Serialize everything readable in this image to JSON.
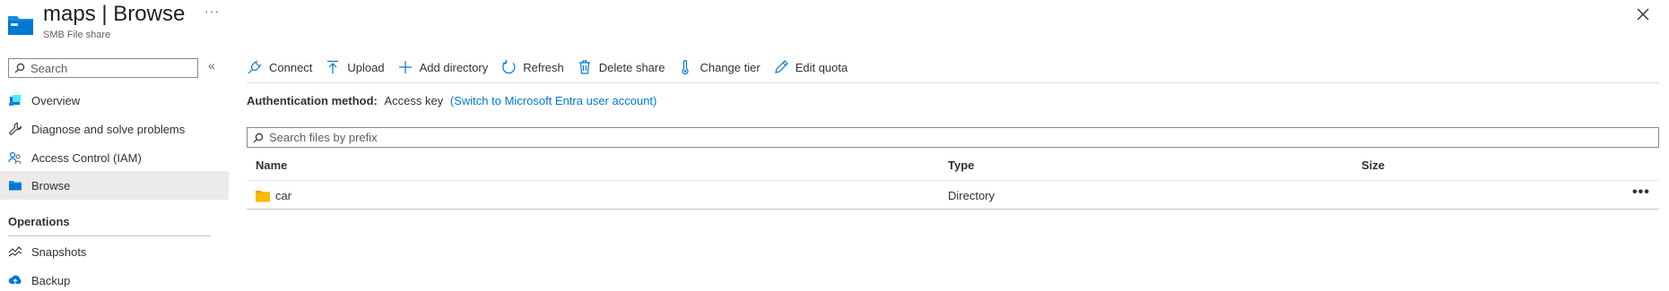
{
  "header": {
    "resource_name": "maps",
    "separator": "|",
    "page": "Browse",
    "subtitle": "SMB File share",
    "more": "···"
  },
  "sidebar": {
    "search_placeholder": "Search",
    "collapse_glyph": "«",
    "items": [
      {
        "label": "Overview",
        "icon": "overview-icon"
      },
      {
        "label": "Diagnose and solve problems",
        "icon": "wrench-icon"
      },
      {
        "label": "Access Control (IAM)",
        "icon": "people-icon"
      },
      {
        "label": "Browse",
        "icon": "folder-icon",
        "active": true
      }
    ],
    "section_operations": "Operations",
    "ops_items": [
      {
        "label": "Snapshots",
        "icon": "snapshots-icon"
      },
      {
        "label": "Backup",
        "icon": "backup-icon"
      }
    ]
  },
  "toolbar": {
    "connect": "Connect",
    "upload": "Upload",
    "add_directory": "Add directory",
    "refresh": "Refresh",
    "delete_share": "Delete share",
    "change_tier": "Change tier",
    "edit_quota": "Edit quota"
  },
  "auth": {
    "label": "Authentication method:",
    "value": "Access key",
    "switch_link": "(Switch to Microsoft Entra user account)"
  },
  "files": {
    "search_placeholder": "Search files by prefix",
    "columns": {
      "name": "Name",
      "type": "Type",
      "size": "Size"
    },
    "rows": [
      {
        "name": "car",
        "type": "Directory",
        "size": "",
        "more": "•••"
      }
    ]
  },
  "colors": {
    "accent": "#0078d4",
    "folder": "#ffb900",
    "active_bg": "#edebe9"
  }
}
